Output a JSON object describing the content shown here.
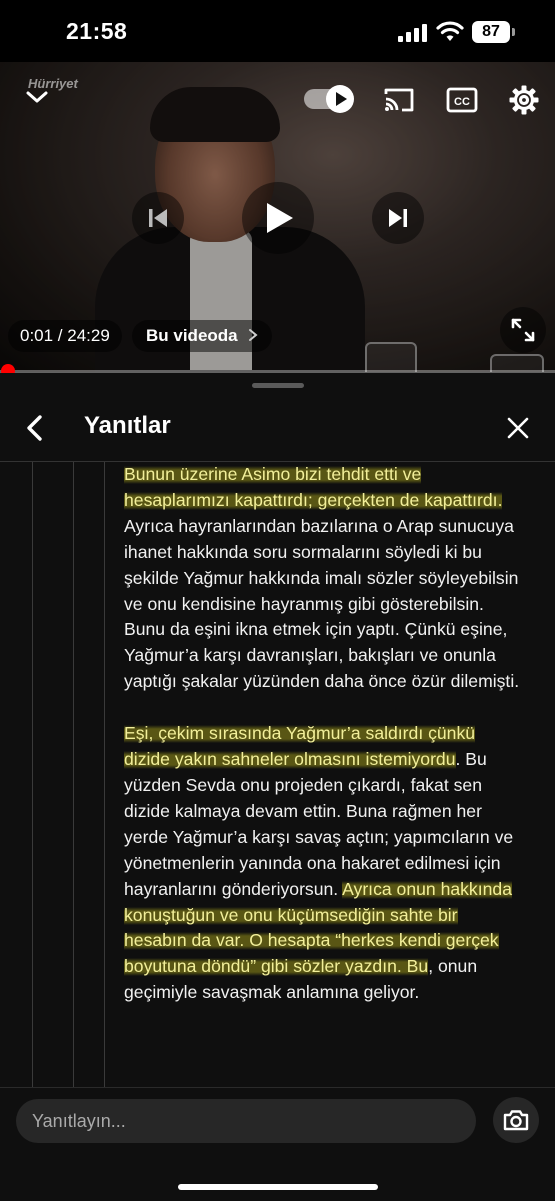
{
  "status_bar": {
    "time": "21:58",
    "battery": "87"
  },
  "video": {
    "channel_logo": "Hürriyet",
    "current_time": "0:01",
    "duration": "24:29",
    "time_display": "0:01 / 24:29",
    "chapter_button": "Bu videoda",
    "progress": 0.0007,
    "icons": [
      "chevron-down-icon",
      "autoplay-toggle-icon",
      "cast-icon",
      "cc-icon",
      "gear-icon",
      "previous-icon",
      "play-icon",
      "next-icon",
      "fullscreen-icon"
    ]
  },
  "replies_panel": {
    "title": "Yanıtlar",
    "comment": {
      "p1_hl": "Bunun üzerine Asimo bizi tehdit etti ve hesaplarımızı kapattırdı; gerçekten de kapattırdı.",
      "p1_rest": " Ayrıca hayranlarından bazılarına o Arap sunucuya ihanet hakkında soru sormalarını söyledi ki bu şekilde Yağmur hakkında imalı sözler söyleyebilsin ve onu kendisine hayranmış gibi gösterebilsin. Bunu da eşini ikna etmek için yaptı. Çünkü eşine, Yağmur’a karşı davranışları, bakışları ve onunla yaptığı şakalar yüzünden daha önce özür dilemişti.",
      "p2_hl1": "Eşi, çekim sırasında Yağmur’a saldırdı çünkü dizide yakın sahneler olmasını istemiyordu",
      "p2_mid": ". Bu yüzden Sevda onu projeden çıkardı, fakat sen dizide kalmaya devam ettin. Buna rağmen her yerde Yağmur’a karşı savaş açtın; yapımcıların ve yönetmenlerin yanında ona hakaret edilmesi için hayranlarını gönderiyorsun. ",
      "p2_hl2": "Ayrıca onun hakkında konuştuğun ve onu küçümsediğin sahte bir hesabın da var. O hesapta “herkes kendi gerçek boyutuna döndü” gibi sözler yazdın. Bu",
      "p2_end": ", onun geçimiyle savaşmak anlamına geliyor."
    },
    "reply_placeholder": "Yanıtlayın..."
  },
  "colors": {
    "progress": "#ff0000",
    "highlight": "#9a9419",
    "background": "#0f0f0f"
  }
}
